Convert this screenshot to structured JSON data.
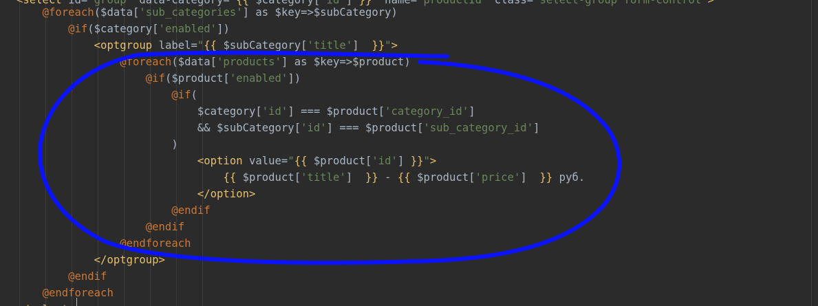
{
  "code_lines": [
    {
      "indent": "    ",
      "tokens": [
        {
          "cls": "directive",
          "text": "@foreach"
        },
        {
          "cls": "plain",
          "text": "($data["
        },
        {
          "cls": "str",
          "text": "'sub_categories'"
        },
        {
          "cls": "plain",
          "text": "] as $key=>$subCategory)"
        }
      ]
    },
    {
      "indent": "        ",
      "tokens": [
        {
          "cls": "directive",
          "text": "@if"
        },
        {
          "cls": "plain",
          "text": "($category["
        },
        {
          "cls": "str",
          "text": "'enabled'"
        },
        {
          "cls": "plain",
          "text": "])"
        }
      ]
    },
    {
      "indent": "            ",
      "tokens": [
        {
          "cls": "tag",
          "text": "<optgroup "
        },
        {
          "cls": "plain",
          "text": "label="
        },
        {
          "cls": "str",
          "text": "\""
        },
        {
          "cls": "tpl",
          "text": "{{ "
        },
        {
          "cls": "var",
          "text": "$subCategory["
        },
        {
          "cls": "str",
          "text": "'title'"
        },
        {
          "cls": "var",
          "text": "] "
        },
        {
          "cls": "tpl",
          "text": " }}"
        },
        {
          "cls": "str",
          "text": "\""
        },
        {
          "cls": "tag",
          "text": ">"
        }
      ]
    },
    {
      "indent": "                ",
      "tokens": [
        {
          "cls": "directive",
          "text": "@foreach"
        },
        {
          "cls": "plain",
          "text": "($data["
        },
        {
          "cls": "str",
          "text": "'products'"
        },
        {
          "cls": "plain",
          "text": "] as $key=>$product)"
        }
      ]
    },
    {
      "indent": "                    ",
      "tokens": [
        {
          "cls": "directive",
          "text": "@if"
        },
        {
          "cls": "plain",
          "text": "($product["
        },
        {
          "cls": "str",
          "text": "'enabled'"
        },
        {
          "cls": "plain",
          "text": "])"
        }
      ]
    },
    {
      "indent": "                        ",
      "tokens": [
        {
          "cls": "directive",
          "text": "@if"
        },
        {
          "cls": "plain",
          "text": "("
        }
      ]
    },
    {
      "indent": "                            ",
      "tokens": [
        {
          "cls": "plain",
          "text": "$category["
        },
        {
          "cls": "str",
          "text": "'id'"
        },
        {
          "cls": "plain",
          "text": "] === $product["
        },
        {
          "cls": "str",
          "text": "'category_id'"
        },
        {
          "cls": "plain",
          "text": "]"
        }
      ]
    },
    {
      "indent": "                            ",
      "tokens": [
        {
          "cls": "plain",
          "text": "&& $subCategory["
        },
        {
          "cls": "str",
          "text": "'id'"
        },
        {
          "cls": "plain",
          "text": "] === $product["
        },
        {
          "cls": "str",
          "text": "'sub_category_id'"
        },
        {
          "cls": "plain",
          "text": "]"
        }
      ]
    },
    {
      "indent": "                        ",
      "tokens": [
        {
          "cls": "plain",
          "text": ")"
        }
      ]
    },
    {
      "indent": "                            ",
      "tokens": [
        {
          "cls": "tag",
          "text": "<option "
        },
        {
          "cls": "plain",
          "text": "value="
        },
        {
          "cls": "str",
          "text": "\""
        },
        {
          "cls": "tpl",
          "text": "{{ "
        },
        {
          "cls": "var",
          "text": "$product["
        },
        {
          "cls": "str",
          "text": "'id'"
        },
        {
          "cls": "var",
          "text": "] "
        },
        {
          "cls": "tpl",
          "text": "}}"
        },
        {
          "cls": "str",
          "text": "\""
        },
        {
          "cls": "tag",
          "text": ">"
        }
      ]
    },
    {
      "indent": "                                ",
      "tokens": [
        {
          "cls": "tpl",
          "text": "{{ "
        },
        {
          "cls": "var",
          "text": "$product["
        },
        {
          "cls": "str",
          "text": "'title'"
        },
        {
          "cls": "var",
          "text": "]  "
        },
        {
          "cls": "tpl",
          "text": "}}"
        },
        {
          "cls": "plain",
          "text": " - "
        },
        {
          "cls": "tpl",
          "text": "{{ "
        },
        {
          "cls": "var",
          "text": "$product["
        },
        {
          "cls": "str",
          "text": "'price'"
        },
        {
          "cls": "var",
          "text": "]  "
        },
        {
          "cls": "tpl",
          "text": "}}"
        },
        {
          "cls": "plain",
          "text": " руб."
        }
      ]
    },
    {
      "indent": "                            ",
      "tokens": [
        {
          "cls": "tag",
          "text": "</option>"
        }
      ]
    },
    {
      "indent": "                        ",
      "tokens": [
        {
          "cls": "directive",
          "text": "@endif"
        }
      ]
    },
    {
      "indent": "                    ",
      "tokens": [
        {
          "cls": "directive",
          "text": "@endif"
        }
      ]
    },
    {
      "indent": "                ",
      "tokens": [
        {
          "cls": "directive",
          "text": "@endforeach"
        }
      ]
    },
    {
      "indent": "            ",
      "tokens": [
        {
          "cls": "tag",
          "text": "</optgroup>"
        }
      ]
    },
    {
      "indent": "        ",
      "tokens": [
        {
          "cls": "directive",
          "text": "@endif"
        }
      ]
    },
    {
      "indent": "    ",
      "tokens": [
        {
          "cls": "directive",
          "text": "@endforeach"
        }
      ]
    }
  ],
  "partial_top_line": [
    {
      "cls": "tag",
      "text": "<select "
    },
    {
      "cls": "plain",
      "text": "id="
    },
    {
      "cls": "str",
      "text": "\"group\""
    },
    {
      "cls": "plain",
      "text": " data-category="
    },
    {
      "cls": "str",
      "text": "\""
    },
    {
      "cls": "tpl",
      "text": "{{ "
    },
    {
      "cls": "var",
      "text": "$category["
    },
    {
      "cls": "str",
      "text": "'id'"
    },
    {
      "cls": "var",
      "text": "] "
    },
    {
      "cls": "tpl",
      "text": "}}"
    },
    {
      "cls": "str",
      "text": "\""
    },
    {
      "cls": "plain",
      "text": " name="
    },
    {
      "cls": "str",
      "text": "\"productId\""
    },
    {
      "cls": "plain",
      "text": " class="
    },
    {
      "cls": "str",
      "text": "\"select-group form-control\""
    },
    {
      "cls": "tag",
      "text": ">"
    }
  ],
  "partial_bottom_line": [
    {
      "cls": "tag",
      "text": "</select>"
    }
  ],
  "colors": {
    "background": "#2b2b2b",
    "annotation_stroke": "#0a12ff"
  }
}
